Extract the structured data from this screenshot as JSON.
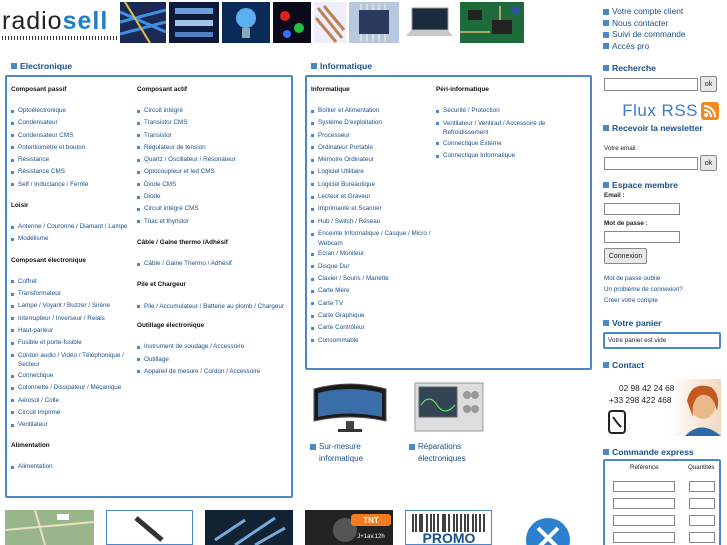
{
  "logo": {
    "text_a": "radio",
    "text_b": "sell"
  },
  "top_links": [
    "Votre compte client",
    "Nous contacter",
    "Suivi de commande",
    "Accès pro"
  ],
  "electronique": {
    "title": "Electronique",
    "col1": [
      {
        "heading": "Composant passif",
        "items": [
          "Optoélectronique",
          "Condensateur",
          "Condensateur CMS",
          "Potentiomètre et bouton",
          "Résistance",
          "Résistance CMS",
          "Self / Inductance / Ferrite"
        ]
      },
      {
        "heading": "Loisir",
        "items": [
          "Antenne / Couronne / Diamant / Lampe",
          "Modélisme"
        ]
      },
      {
        "heading": "Composant électronique",
        "items": [
          "Coffret",
          "Transformateur",
          "Lampe / Voyant / Buzzer / Sirène",
          "Interrupteur / Inverseur / Relais",
          "Haut-parleur",
          "Fusible et porte-fusible",
          "Cordon audio / Vidéo / Téléphonique / Secteur",
          "Connectique",
          "Colonnette / Dissipateur / Mécanique",
          "Aérosol / Colle",
          "Circuit Imprimé",
          "Ventilateur"
        ]
      },
      {
        "heading": "Alimentation",
        "items": [
          "Alimentation"
        ]
      }
    ],
    "col2": [
      {
        "heading": "Composant actif",
        "items": [
          "Circuit intégré",
          "Transistor CMS",
          "Transistor",
          "Régulateur de tension",
          "Quartz / Oscillateur / Résonateur",
          "Optocoupleur et led CMS",
          "Diode CMS",
          "Diode",
          "Circuit intégré CMS",
          "Triac et thyristor"
        ]
      },
      {
        "heading": "Câble / Gaine thermo /Adhésif",
        "items": [
          "Câble / Gaine Thermo / Adhésif"
        ]
      },
      {
        "heading": "Pile et Chargeur",
        "items": [
          "Pile / Accumulateur / Batterie au plomb / Chargeur"
        ]
      },
      {
        "heading": "Outillage électronique",
        "items": [
          "Instrument de soudage / Accessoire",
          "Outillage",
          "Appareil de mesure / Cordon / Accessoire"
        ]
      }
    ]
  },
  "informatique": {
    "title": "Informatique",
    "col1": [
      {
        "heading": "Informatique",
        "items": [
          "Boîtier et Alimentation",
          "Système D'exploitation",
          "Processeur",
          "Ordinateur Portable",
          "Mémoire Ordinateur",
          "Logiciel Utilitaire",
          "Logiciel Bureautique",
          "Lecteur et Graveur",
          "Imprimante et Scanner",
          "Hub / Switch / Réseau",
          "Enceinte Informatique / Casque / Micro / Webcam",
          "Ecran / Moniteur",
          "Disque Dur",
          "Clavier / Souris / Manette",
          "Carte Mère",
          "Carte TV",
          "Carte Graphique",
          "Carte Contrôleur",
          "Consommable"
        ]
      }
    ],
    "col2": [
      {
        "heading": "Péri-informatique",
        "items": [
          "Sécurité / Protection",
          "Ventilateur / Ventirad / Accessoire de Refroidissement",
          "Connectique Externe",
          "Connectique Informatique"
        ]
      }
    ],
    "promo1": "Sur-mesure informatique",
    "promo2": "Réparations électroniques"
  },
  "recherche": {
    "title": "Recherche",
    "ok": "ok"
  },
  "rss": {
    "text": "Flux RSS"
  },
  "newsletter": {
    "title": "Recevoir la newsletter",
    "email_label": "Votre email :",
    "ok": "ok"
  },
  "espace": {
    "title": "Espace membre",
    "email_label": "Email :",
    "pass_label": "Mot de passe :",
    "connect": "Connexion",
    "links": [
      "Mot de passe oublié",
      "Un problème de connexion?",
      "Créer votre compte"
    ]
  },
  "panier": {
    "title": "Votre panier",
    "empty": "Votre panier est vide"
  },
  "contact": {
    "title": "Contact",
    "phone1": "02 98 42 24 68",
    "phone2": "+33 298 422 468"
  },
  "express": {
    "title": "Commande express",
    "col1": "Référence",
    "col2": "Quantités"
  },
  "bottom": {
    "promo": "PROMO",
    "tnt": "TNT",
    "tnt_sub": "J+1av.12h"
  },
  "colors": {
    "accent": "#4a88c7",
    "link": "#1a4f8a"
  }
}
